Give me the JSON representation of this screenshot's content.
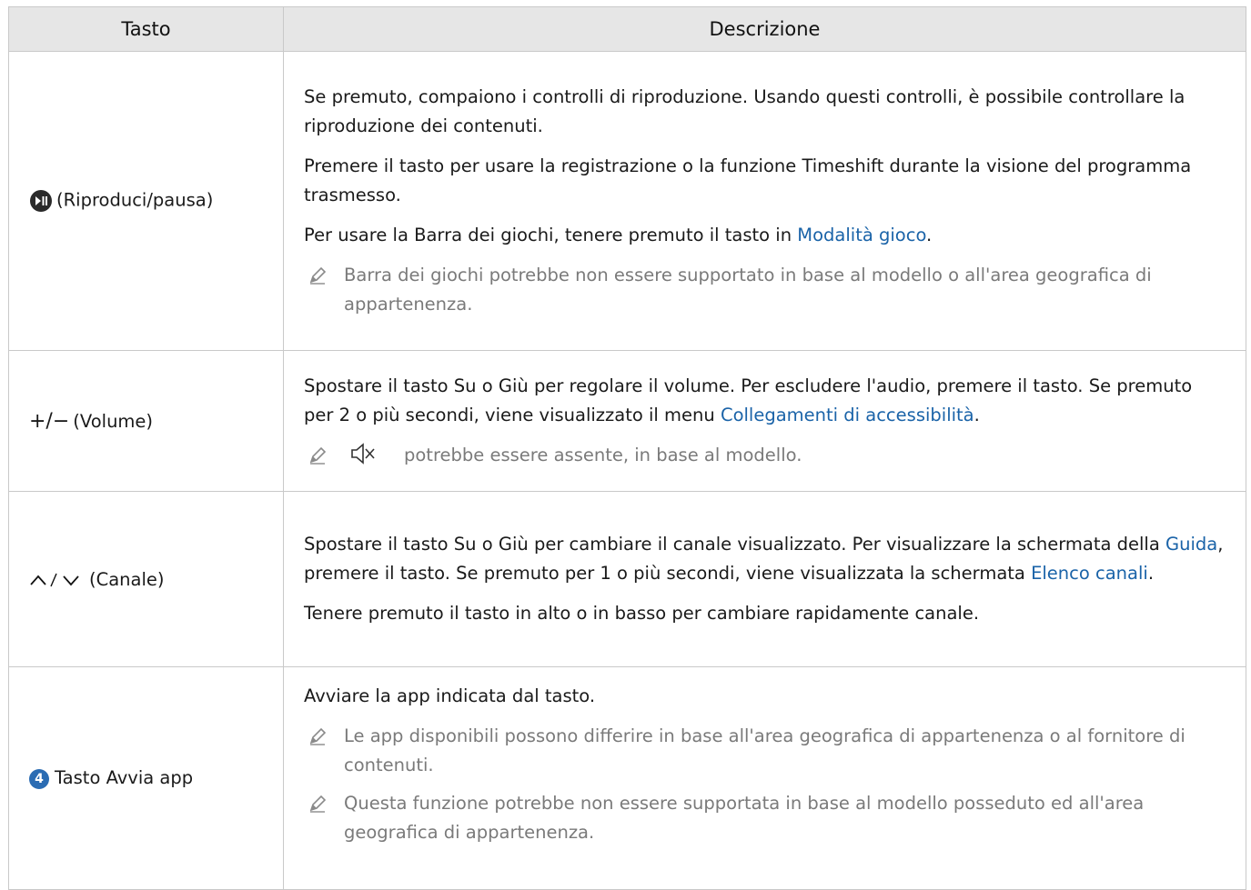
{
  "table": {
    "headers": [
      "Tasto",
      "Descrizione"
    ],
    "rows": [
      {
        "key_icon": "play-pause-icon",
        "key_label": "(Riproduci/pausa)",
        "p1": "Se premuto, compaiono i controlli di riproduzione. Usando questi controlli, è possibile controllare la riproduzione dei contenuti.",
        "p2": "Premere il tasto per usare la registrazione o la funzione Timeshift durante la visione del programma trasmesso.",
        "p3_pre": "Per usare la Barra dei giochi, tenere premuto il tasto in ",
        "p3_link": "Modalità gioco",
        "p3_post": ".",
        "note1": "Barra dei giochi potrebbe non essere supportato in base al modello o all'area geografica di appartenenza."
      },
      {
        "key_icon": "plus-minus-icon",
        "key_symbols": "+/−",
        "key_label": "(Volume)",
        "p1_pre": "Spostare il tasto Su o Giù per regolare il volume. Per escludere l'audio, premere il tasto. Se premuto per 2 o più secondi, viene visualizzato il menu ",
        "p1_link": "Collegamenti di accessibilità",
        "p1_post": ".",
        "note1_icon": "mute-icon",
        "note1": "potrebbe essere assente, in base al modello."
      },
      {
        "key_icon": "chevron-up-down-icon",
        "key_label": "(Canale)",
        "p1_pre": "Spostare il tasto Su o Giù per cambiare il canale visualizzato. Per visualizzare la schermata della ",
        "p1_link1": "Guida",
        "p1_mid": ", premere il tasto. Se premuto per 1 o più secondi, viene visualizzata la schermata ",
        "p1_link2": "Elenco canali",
        "p1_post": ".",
        "p2": "Tenere premuto il tasto in alto o in basso per cambiare rapidamente canale."
      },
      {
        "key_badge": "4",
        "key_label": "Tasto Avvia app",
        "p1": "Avviare la app indicata dal tasto.",
        "note1": "Le app disponibili possono differire in base all'area geografica di appartenenza o al fornitore di contenuti.",
        "note2": "Questa funzione potrebbe non essere supportata in base al modello posseduto ed all'area geografica di appartenenza."
      }
    ]
  },
  "colors": {
    "header_bg": "#e6e6e6",
    "link": "#1a63a8",
    "note_text": "#7a7a7a",
    "border": "#c9c9c9"
  }
}
